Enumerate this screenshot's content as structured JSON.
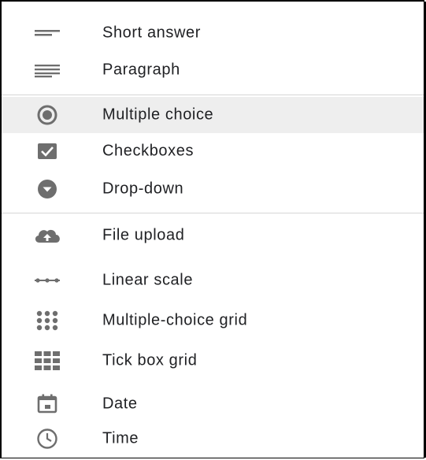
{
  "menu": {
    "items": [
      {
        "label": "Short answer",
        "icon": "short-answer-icon"
      },
      {
        "label": "Paragraph",
        "icon": "paragraph-icon"
      },
      {
        "label": "Multiple choice",
        "icon": "radio-button-icon",
        "selected": true
      },
      {
        "label": "Checkboxes",
        "icon": "checkbox-icon"
      },
      {
        "label": "Drop-down",
        "icon": "dropdown-icon"
      },
      {
        "label": "File upload",
        "icon": "cloud-upload-icon"
      },
      {
        "label": "Linear scale",
        "icon": "linear-scale-icon"
      },
      {
        "label": "Multiple-choice grid",
        "icon": "radio-grid-icon"
      },
      {
        "label": "Tick box grid",
        "icon": "tick-grid-icon"
      },
      {
        "label": "Date",
        "icon": "calendar-icon"
      },
      {
        "label": "Time",
        "icon": "clock-icon"
      }
    ]
  },
  "colors": {
    "icon": "#6e6e6e",
    "text": "#202124",
    "selected_background": "#eeeeee",
    "divider": "#d6d6d6"
  }
}
